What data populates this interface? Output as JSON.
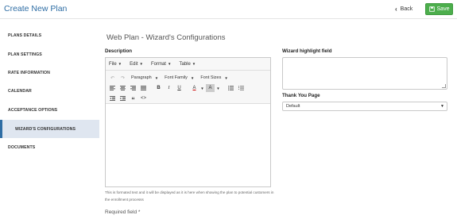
{
  "header": {
    "title": "Create New Plan",
    "back_label": "Back",
    "save_label": "Save",
    "accent_color": "#2e6da4",
    "save_color": "#4cae4c"
  },
  "sidebar": {
    "items": [
      {
        "label": "PLANS DETAILS"
      },
      {
        "label": "PLAN SETTINGS"
      },
      {
        "label": "RATE INFORMATION"
      },
      {
        "label": "CALENDAR"
      },
      {
        "label": "ACCEPTANCE OPTIONS"
      },
      {
        "label": "WIZARD'S CONFIGURATIONS",
        "active": true
      },
      {
        "label": "DOCUMENTS"
      }
    ]
  },
  "main": {
    "title": "Web Plan - Wizard's Configurations",
    "description_label": "Description",
    "editor": {
      "menus": [
        "File",
        "Edit",
        "Format",
        "Table"
      ],
      "paragraph": "Paragraph",
      "font_family": "Font Family",
      "font_sizes": "Font Sizes",
      "icons": {
        "undo": "undo-icon",
        "redo": "redo-icon",
        "align_left": "align-left-icon",
        "align_center": "align-center-icon",
        "align_right": "align-right-icon",
        "align_justify": "align-justify-icon",
        "bold": "B",
        "italic": "I",
        "underline": "U",
        "text_color": "A",
        "bg_color": "A",
        "bullet_list": "bullet-list-icon",
        "numbered_list": "numbered-list-icon",
        "outdent": "outdent-icon",
        "indent": "indent-icon",
        "quote": "“",
        "code": "<>"
      },
      "helper_text": "This is formated text and it will be displayed as it is here when showing the plan to potential customers in the enrollment processs"
    },
    "required_text": "Required field *",
    "highlight_label": "Wizard highlight field",
    "thank_you_label": "Thank You Page",
    "thank_you_value": "Default"
  }
}
